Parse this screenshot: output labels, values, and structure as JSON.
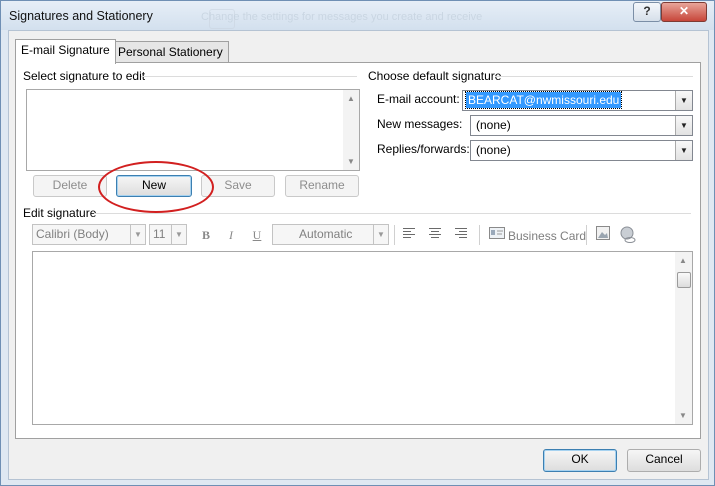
{
  "window": {
    "title": "Signatures and Stationery",
    "ghost_text": "Change the settings for messages you create and receive"
  },
  "titlebar": {
    "help_label": "?",
    "close_label": "✕"
  },
  "tabs": [
    {
      "label": "E-mail Signature"
    },
    {
      "label": "Personal Stationery"
    }
  ],
  "select_section": {
    "label": "Select signature to edit",
    "buttons": {
      "delete": "Delete",
      "new": "New",
      "save": "Save",
      "rename": "Rename"
    }
  },
  "default_section": {
    "label": "Choose default signature",
    "email_account_label": "E-mail account:",
    "email_account_value": "BEARCAT@nwmissouri.edu",
    "new_messages_label": "New messages:",
    "new_messages_value": "(none)",
    "replies_label": "Replies/forwards:",
    "replies_value": "(none)"
  },
  "edit_section": {
    "label": "Edit signature",
    "font_name": "Calibri (Body)",
    "font_size": "11",
    "bold": "B",
    "italic": "I",
    "underline": "U",
    "color": "Automatic",
    "business_card": "Business Card"
  },
  "footer": {
    "ok": "OK",
    "cancel": "Cancel"
  },
  "icons": {
    "bold": "bold-icon",
    "italic": "italic-icon",
    "underline": "underline-icon",
    "align_left": "align-left-icon",
    "align_center": "align-center-icon",
    "align_right": "align-right-icon",
    "business_card": "business-card-icon",
    "picture": "picture-icon",
    "hyperlink": "hyperlink-icon"
  },
  "colors": {
    "selection": "#3399ff",
    "highlight_circle": "#d22020",
    "default_button": "#3c7fb1"
  }
}
